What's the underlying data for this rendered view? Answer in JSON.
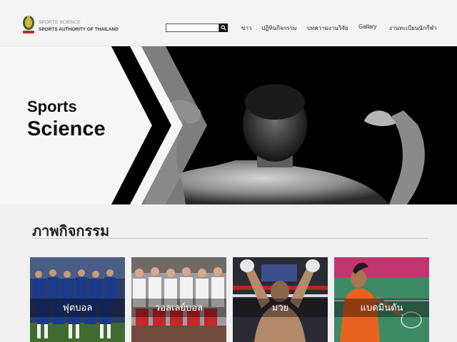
{
  "header": {
    "brand_line1": "SPORTS SCIENCE",
    "brand_line2": "SPORTS AUTHORITY OF THAILAND",
    "logo_icon": "sat-emblem-icon",
    "search": {
      "value": "",
      "placeholder": "",
      "icon": "search-icon"
    }
  },
  "nav": {
    "items": [
      {
        "label": "ข่าว"
      },
      {
        "label": "ปฏิทินกิจกรรม"
      },
      {
        "label": "บทความงานวิจัย"
      },
      {
        "label": "Gallary"
      },
      {
        "label": "งานทะเบียนนักกีฬา"
      }
    ]
  },
  "hero": {
    "title_line1": "Sports",
    "title_line2": "Science"
  },
  "gallery": {
    "title": "ภาพกิจกรรม",
    "cards": [
      {
        "label": "ฟุตบอล"
      },
      {
        "label": "วอลเลย์บอล"
      },
      {
        "label": "มวย"
      },
      {
        "label": "แบดมินตัน"
      }
    ]
  },
  "colors": {
    "accent_dark": "#000000",
    "chevron_gray": "#8c8c8c",
    "page_bg": "#f1f1f1",
    "football_blue": "#1d3a8a",
    "volleyball_red": "#c8262b",
    "badminton_orange": "#e8621f"
  }
}
